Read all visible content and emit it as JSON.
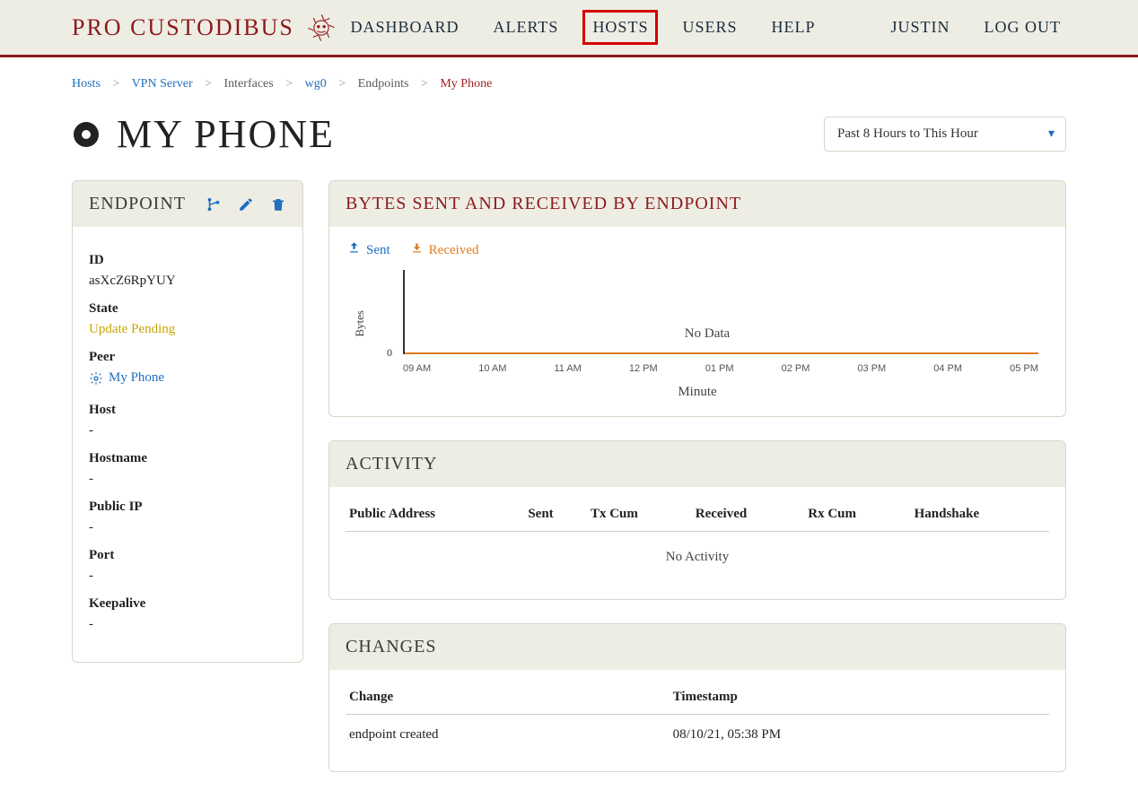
{
  "brand": {
    "name": "PRO CUSTODIBUS"
  },
  "nav": {
    "items": [
      {
        "label": "DASHBOARD",
        "key": "dashboard"
      },
      {
        "label": "ALERTS",
        "key": "alerts"
      },
      {
        "label": "HOSTS",
        "key": "hosts"
      },
      {
        "label": "USERS",
        "key": "users"
      },
      {
        "label": "HELP",
        "key": "help"
      }
    ],
    "highlight_key": "hosts",
    "user": "JUSTIN",
    "logout": "LOG OUT"
  },
  "breadcrumb": {
    "hosts": "Hosts",
    "vpn": "VPN Server",
    "interfaces": "Interfaces",
    "wg0": "wg0",
    "endpoints": "Endpoints",
    "current": "My Phone"
  },
  "page_title": "MY PHONE",
  "range": {
    "label": "Past 8 Hours to This Hour"
  },
  "endpoint_panel": {
    "title": "ENDPOINT",
    "id_label": "ID",
    "id_value": "asXcZ6RpYUY",
    "state_label": "State",
    "state_value": "Update Pending",
    "peer_label": "Peer",
    "peer_value": "My Phone",
    "host_label": "Host",
    "host_value": "-",
    "hostname_label": "Hostname",
    "hostname_value": "-",
    "publicip_label": "Public IP",
    "publicip_value": "-",
    "port_label": "Port",
    "port_value": "-",
    "keepalive_label": "Keepalive",
    "keepalive_value": "-"
  },
  "chart_panel": {
    "title": "BYTES SENT AND RECEIVED BY ENDPOINT",
    "legend_sent": "Sent",
    "legend_recv": "Received",
    "ylabel": "Bytes",
    "xlabel": "Minute",
    "nodata": "No Data",
    "tick0": "0"
  },
  "chart_data": {
    "type": "line",
    "title": "Bytes Sent and Received by Endpoint",
    "xlabel": "Minute",
    "ylabel": "Bytes",
    "ylim": [
      0,
      0
    ],
    "x_categories": [
      "09 AM",
      "10 AM",
      "11 AM",
      "12 PM",
      "01 PM",
      "02 PM",
      "03 PM",
      "04 PM",
      "05 PM"
    ],
    "series": [
      {
        "name": "Sent",
        "color": "#1f6fbf",
        "values": [
          0,
          0,
          0,
          0,
          0,
          0,
          0,
          0,
          0
        ]
      },
      {
        "name": "Received",
        "color": "#e27c1f",
        "values": [
          0,
          0,
          0,
          0,
          0,
          0,
          0,
          0,
          0
        ]
      }
    ],
    "annotation": "No Data"
  },
  "activity_panel": {
    "title": "ACTIVITY",
    "cols": {
      "addr": "Public Address",
      "sent": "Sent",
      "txcum": "Tx Cum",
      "recv": "Received",
      "rxcum": "Rx Cum",
      "hs": "Handshake"
    },
    "empty": "No Activity"
  },
  "changes_panel": {
    "title": "CHANGES",
    "cols": {
      "change": "Change",
      "ts": "Timestamp"
    },
    "rows": [
      {
        "change": "endpoint created",
        "ts": "08/10/21, 05:38 PM"
      }
    ]
  }
}
